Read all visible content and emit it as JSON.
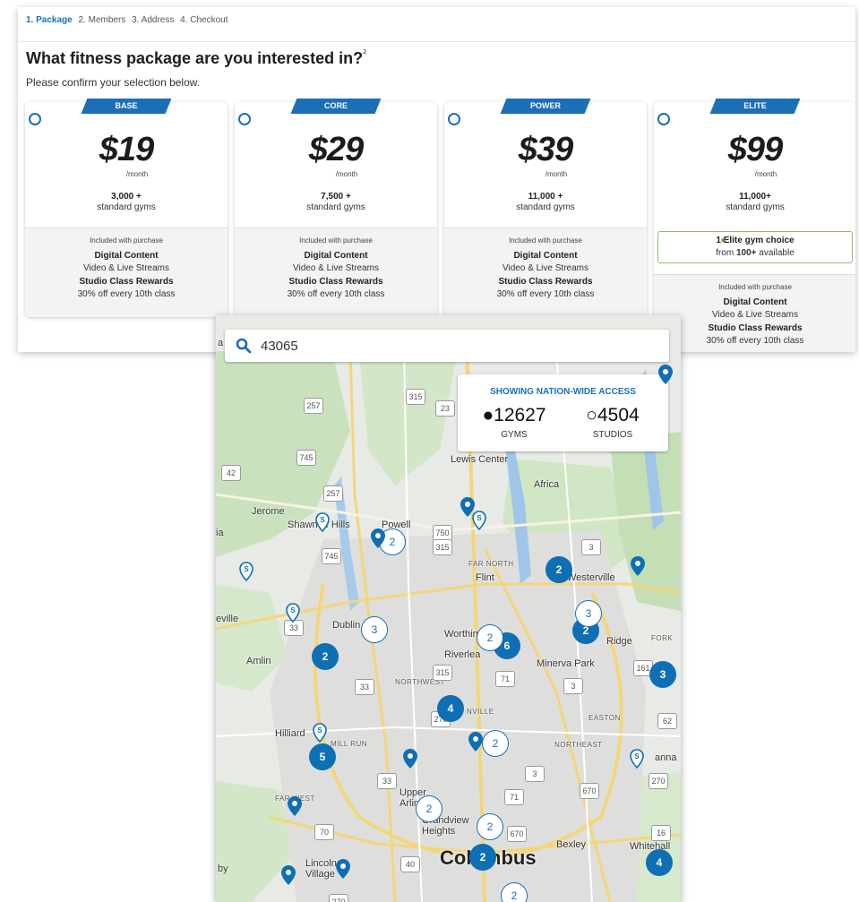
{
  "steps": [
    "1. Package",
    "2. Members",
    "3. Address",
    "4. Checkout"
  ],
  "heading": "What fitness package are you interested in?",
  "heading_sup": "2",
  "subheading": "Please confirm your selection below.",
  "packages": [
    {
      "name": "BASE",
      "price": "$19",
      "per": "/month",
      "count": "3,000 +",
      "count_label": "standard gyms",
      "included": "Included with purchase",
      "f1_title": "Digital Content",
      "f1_desc": "Video & Live Streams",
      "f2_title": "Studio Class Rewards",
      "f2_desc": "30% off every 10th class"
    },
    {
      "name": "CORE",
      "price": "$29",
      "per": "/month",
      "count": "7,500 +",
      "count_label": "standard gyms",
      "included": "Included with purchase",
      "f1_title": "Digital Content",
      "f1_desc": "Video & Live Streams",
      "f2_title": "Studio Class Rewards",
      "f2_desc": "30% off every 10th class"
    },
    {
      "name": "POWER",
      "price": "$39",
      "per": "/month",
      "count": "11,000 +",
      "count_label": "standard gyms",
      "included": "Included with purchase",
      "f1_title": "Digital Content",
      "f1_desc": "Video & Live Streams",
      "f2_title": "Studio Class Rewards",
      "f2_desc": "30% off every 10th class"
    },
    {
      "name": "ELITE",
      "price": "$99",
      "per": "/month",
      "count": "11,000+",
      "count_label": "standard gyms",
      "elite_choice": "1 Elite gym choice",
      "elite_from": "from",
      "elite_num": "100+",
      "elite_avail": "available",
      "included": "Included with purchase",
      "f1_title": "Digital Content",
      "f1_desc": "Video & Live Streams",
      "f2_title": "Studio Class Rewards",
      "f2_desc": "30% off every 10th class"
    }
  ],
  "map": {
    "search_value": "43065",
    "stats_title": "SHOWING NATION-WIDE ACCESS",
    "gyms_count": "12627",
    "gyms_label": "GYMS",
    "studios_count": "4504",
    "studios_label": "STUDIOS",
    "places": {
      "lewis_center": "Lewis Center",
      "africa": "Africa",
      "jerome": "Jerome",
      "shawnee_hills": "Shawnee Hills",
      "powell": "Powell",
      "far_north": "FAR NORTH",
      "flint": "Flint",
      "westerville": "Westerville",
      "eville": "eville",
      "dublin": "Dublin",
      "worthington": "Worthington",
      "amlin": "Amlin",
      "riverlea": "Riverlea",
      "minerva_park": "Minerva Park",
      "ridge": "Ridge",
      "fork": "FORK",
      "northwest": "NORTHWEST",
      "nville": "NVILLE",
      "easton": "EASTON",
      "hilliard": "Hilliard",
      "mill_run": "MILL RUN",
      "northeast": "NORTHEAST",
      "anna": "anna",
      "far_west": "FAR WEST",
      "upper_arlington": "Upper Arlington",
      "grandview_heights": "Grandview Heights",
      "columbus": "Columbus",
      "bexley": "Bexley",
      "whitehall": "Whitehall",
      "lincoln_village": "Lincoln Village",
      "by": "by",
      "a": "a",
      "ia": "ia"
    },
    "shields": [
      "315",
      "23",
      "257",
      "745",
      "42",
      "257",
      "750",
      "315",
      "745",
      "3",
      "33",
      "315",
      "33",
      "3",
      "161",
      "62",
      "3",
      "33",
      "270",
      "70",
      "670",
      "670",
      "270",
      "16",
      "40",
      "71",
      "71",
      "270"
    ],
    "clusters_solid": [
      "2",
      "2",
      "2",
      "6",
      "4",
      "5",
      "2",
      "4",
      "3"
    ],
    "clusters_hollow": [
      "2",
      "3",
      "3",
      "2",
      "2",
      "2",
      "2",
      "2"
    ]
  }
}
